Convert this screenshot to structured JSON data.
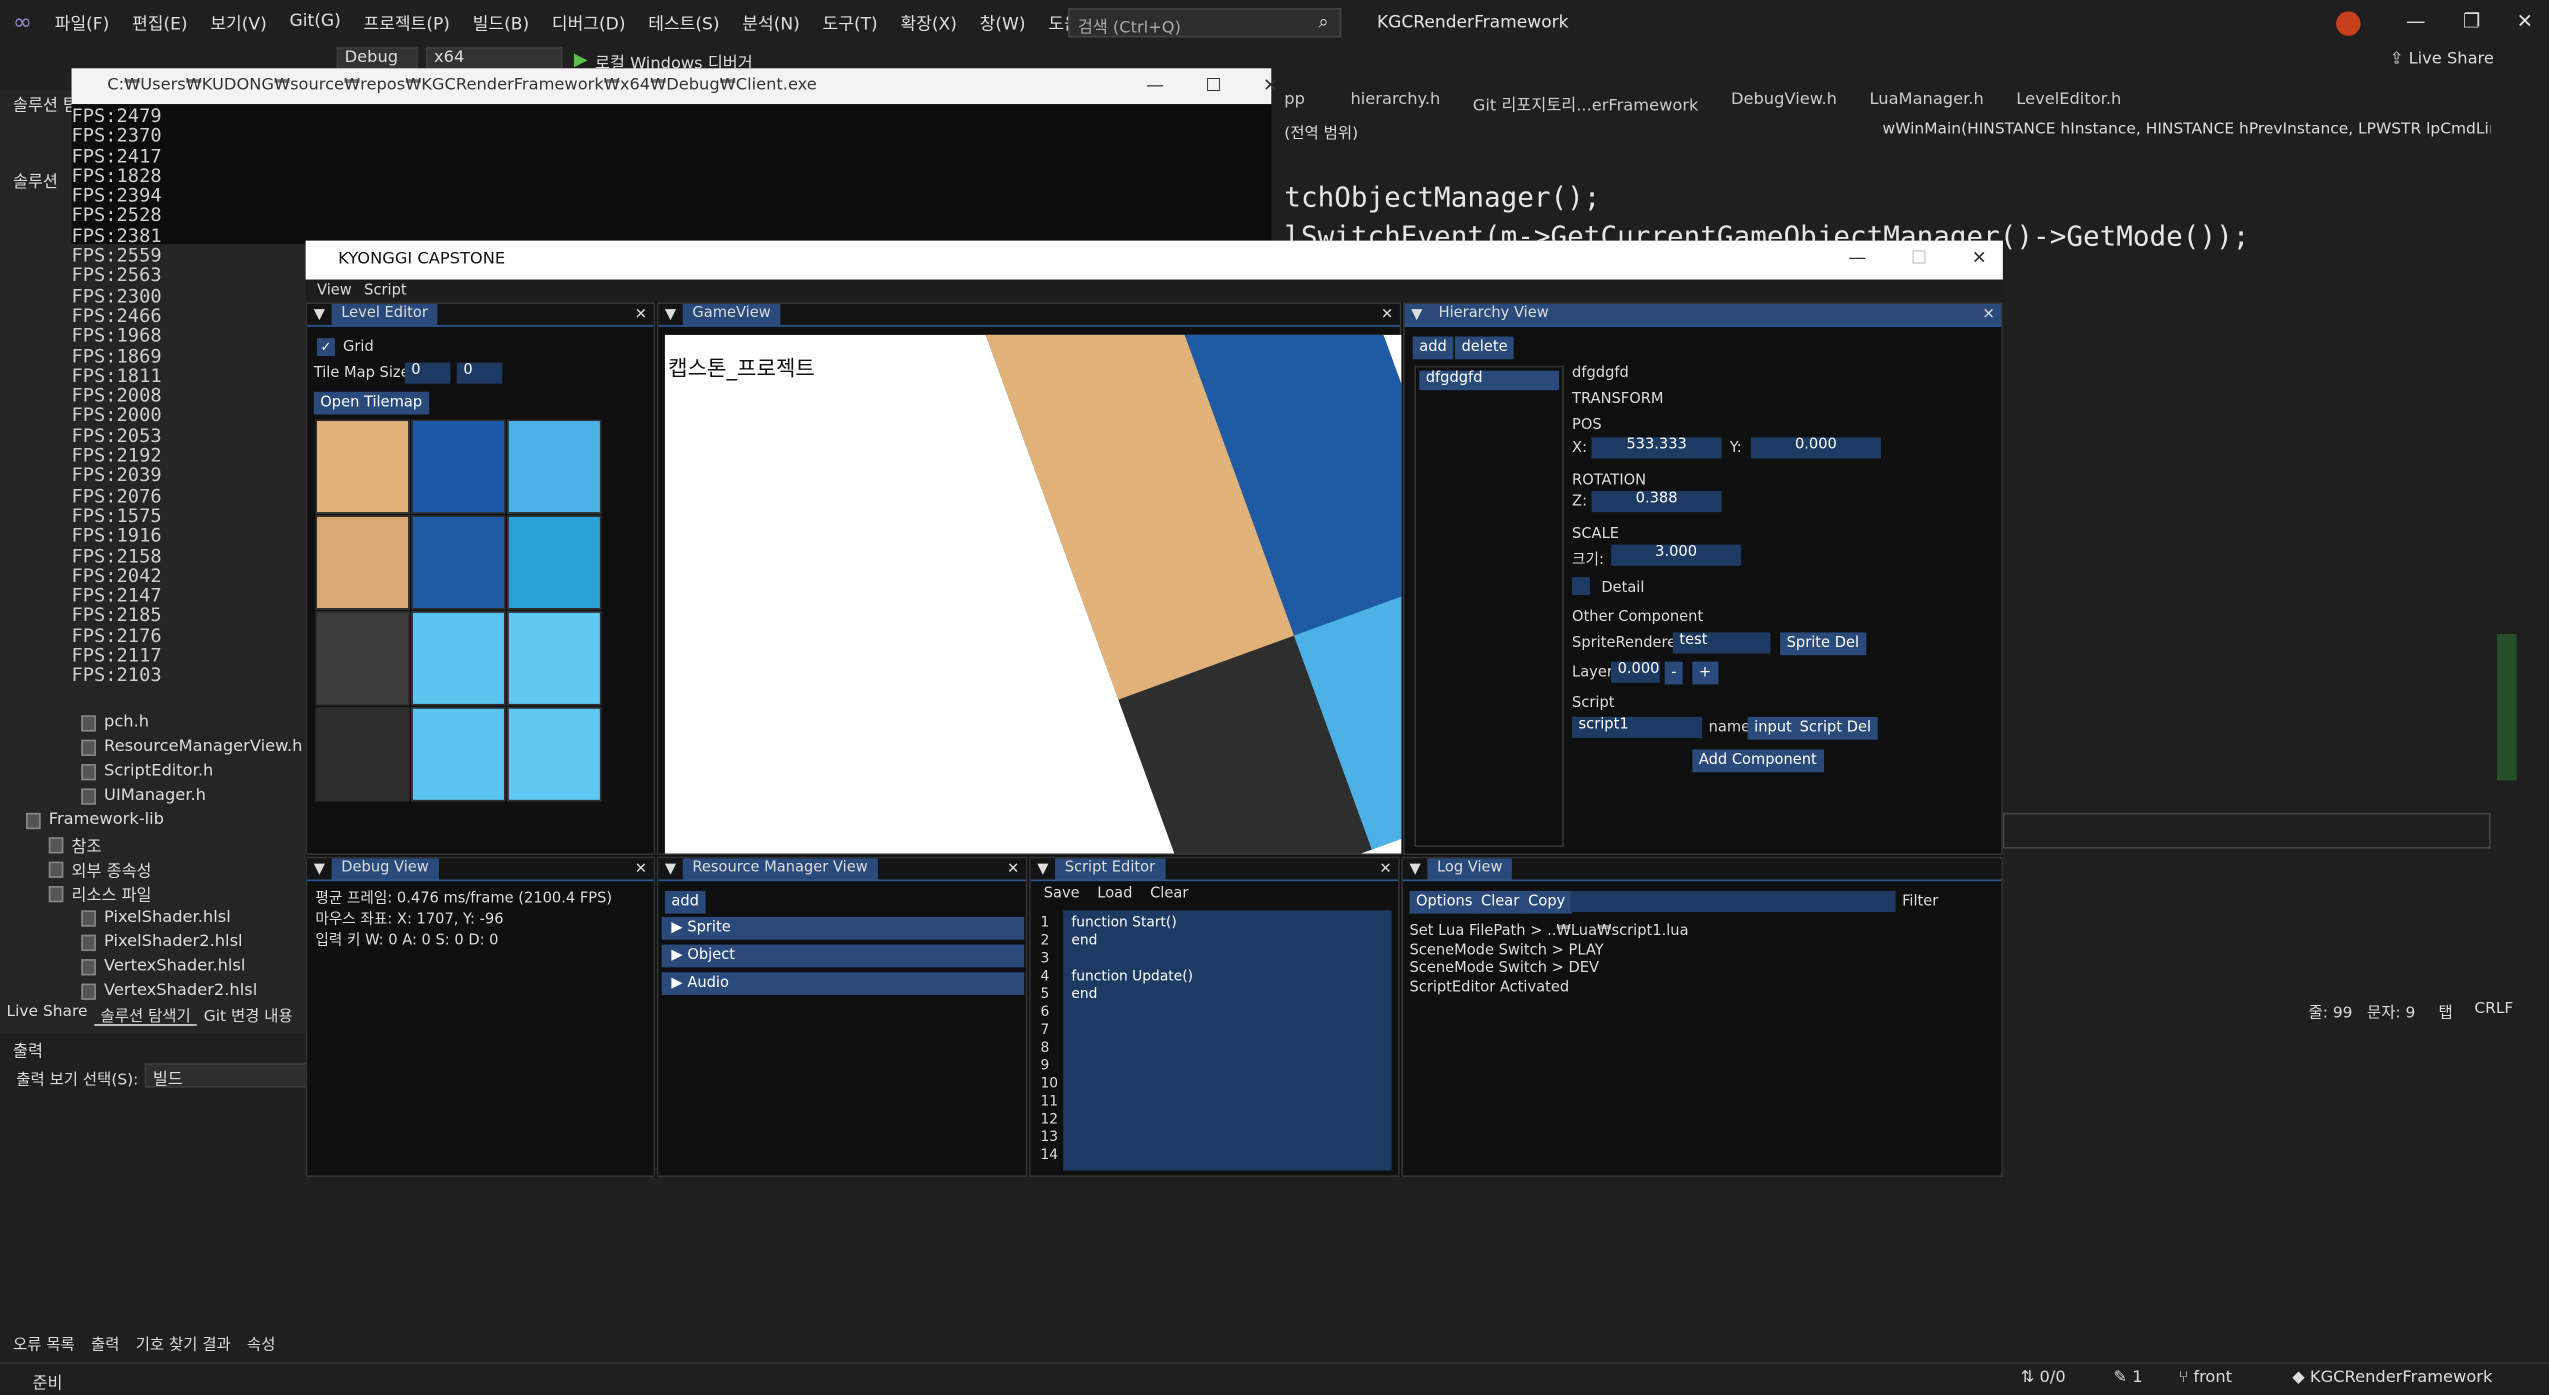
{
  "vs": {
    "menu": [
      "파일(F)",
      "편집(E)",
      "보기(V)",
      "Git(G)",
      "프로젝트(P)",
      "빌드(B)",
      "디버그(D)",
      "테스트(S)",
      "분석(N)",
      "도구(T)",
      "확장(X)",
      "창(W)",
      "도움말(H)"
    ],
    "search_placeholder": "검색 (Ctrl+Q)",
    "title": "KGCRenderFramework",
    "live_share": "Live Share",
    "config": "Debug",
    "platform": "x64",
    "debugger": "로컬 Windows 디버거",
    "tabs": [
      "pp",
      "hierarchy.h",
      "Git 리포지토리...erFramework",
      "DebugView.h",
      "LuaManager.h",
      "LevelEditor.h"
    ],
    "scope": "(전역 범위)",
    "func": "wWinMain(HINSTANCE hInstance, HINSTANCE hPrevInstance, LPWSTR lpCmdLine, i",
    "code": [
      "tchObjectManager();",
      "lSwitchEvent(m->GetCurrentGameObjectManager()->GetMode());"
    ],
    "solution_tabs": [
      "Live Share",
      "솔루션 탐색기",
      "Git 변경 내용"
    ],
    "solution_header": "솔루션 탐",
    "solution_label": "솔루션",
    "solution_items": [
      "pch.h",
      "ResourceManagerView.h",
      "ScriptEditor.h",
      "UIManager.h",
      "Framework-lib",
      "참조",
      "외부 종속성",
      "리소스 파일",
      "PixelShader.hlsl",
      "PixelShader2.hlsl",
      "VertexShader.hlsl",
      "VertexShader2.hlsl"
    ],
    "output_title": "출력",
    "output_select_label": "출력 보기 선택(S):",
    "output_select": "빌드",
    "bottom_tabs": [
      "오류 목록",
      "출력",
      "기호 찾기 결과",
      "속성"
    ],
    "status_ready": "준비",
    "line": "줄: 99",
    "col": "문자: 9",
    "tab": "탭",
    "crlf": "CRLF",
    "git_counts": "0/0",
    "edits": "1",
    "branch": "front",
    "repo": "KGCRenderFramework"
  },
  "console": {
    "title": "C:₩Users₩KUDONG₩source₩repos₩KGCRenderFramework₩x64₩Debug₩Client.exe",
    "fps_lines": [
      "FPS:2479",
      "FPS:2370",
      "FPS:2417",
      "FPS:1828",
      "FPS:2394",
      "FPS:2528",
      "FPS:2381",
      "FPS:2559",
      "FPS:2563",
      "FPS:2300",
      "FPS:2466",
      "FPS:1968",
      "FPS:1869",
      "FPS:1811",
      "FPS:2008",
      "FPS:2000",
      "FPS:2053",
      "FPS:2192",
      "FPS:2039",
      "FPS:2076",
      "FPS:1575",
      "FPS:1916",
      "FPS:2158",
      "FPS:2042",
      "FPS:2147",
      "FPS:2185",
      "FPS:2176",
      "FPS:2117",
      "FPS:2103"
    ]
  },
  "game": {
    "title": "KYONGGI CAPSTONE",
    "menu": [
      "View",
      "Script"
    ],
    "level_editor": {
      "tab": "Level Editor",
      "grid": "Grid",
      "tilemap_size": "Tile Map Size",
      "w": "0",
      "h": "0",
      "open_tilemap": "Open Tilemap"
    },
    "gameview": {
      "tab": "GameView",
      "caption": "캡스톤_프로젝트"
    },
    "hierarchy": {
      "tab": "Hierarchy View",
      "add": "add",
      "delete": "delete",
      "object": "dfgdgfd",
      "name": "dfgdgfd",
      "transform": "TRANSFORM",
      "pos": "POS",
      "x_label": "X:",
      "x": "533.333",
      "y_label": "Y:",
      "y": "0.000",
      "rotation": "ROTATION",
      "z_label": "Z:",
      "z": "0.388",
      "scale": "SCALE",
      "size_label": "크기:",
      "size": "3.000",
      "detail": "Detail",
      "other": "Other Component",
      "sprite_renderer": "SpriteRenderer",
      "sprite": "test",
      "sprite_del": "Sprite Del",
      "layer": "Layer",
      "layer_val": "0.000",
      "minus": "-",
      "plus": "+",
      "script": "Script",
      "script_name": "script1",
      "name_label": "name",
      "input": "input",
      "script_del": "Script Del",
      "add_component": "Add Component"
    },
    "debug": {
      "tab": "Debug View",
      "frame": "평균 프레임: 0.476 ms/frame (2100.4 FPS)",
      "mouse": "마우스 좌표: X: 1707, Y: -96",
      "keys": "입력 키 W: 0 A: 0 S: 0 D: 0"
    },
    "resource": {
      "tab": "Resource Manager View",
      "add": "add",
      "items": [
        "Sprite",
        "Object",
        "Audio"
      ]
    },
    "script_editor": {
      "tab": "Script Editor",
      "save": "Save",
      "load": "Load",
      "clear": "Clear",
      "code": "function Start()\nend\n\nfunction Update()\nend",
      "line_numbers": "1\n2\n3\n4\n5\n6\n7\n8\n9\n10\n11\n12\n13\n14"
    },
    "log": {
      "tab": "Log View",
      "options": "Options",
      "clear": "Clear",
      "copy": "Copy",
      "filter": "Filter",
      "lines": [
        "Set Lua FilePath > ..₩Lua₩script1.lua",
        "SceneMode Switch > PLAY",
        "SceneMode Switch > DEV",
        "ScriptEditor Activated"
      ]
    }
  },
  "colors": {
    "accent": "#294a7a",
    "panel": "#0f0f0f",
    "vs_bg": "#1f1f1f"
  }
}
